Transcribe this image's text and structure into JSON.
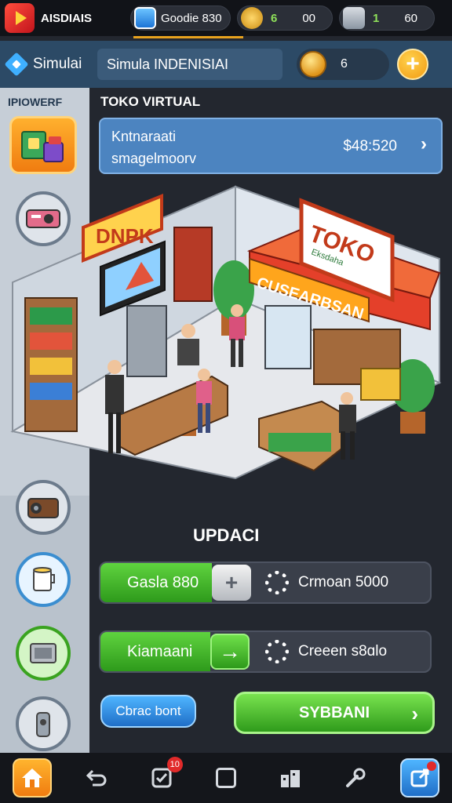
{
  "topbar": {
    "app_name": "AISDIAIS",
    "resource1": "Goodie 830",
    "resource2_green": "6",
    "resource2_value": "00",
    "resource3_green": "1",
    "resource3_value": "60"
  },
  "header": {
    "label": "Simulai",
    "field": "Simula INDENISIAI",
    "coins": "6",
    "plus": "+"
  },
  "sidebar": {
    "title": "IPIOWERF"
  },
  "shop": {
    "title": "TOKO VIRTUAL",
    "info_line1": "Kntnaraati",
    "info_line2": "smagelmoorv",
    "info_price": "$48:520",
    "chevron": "›",
    "scene_sign_left": "DNPK",
    "scene_sign_top": "TOKO",
    "scene_sign_top_sub": "Eksdaha",
    "scene_banner": "CUSEARBSAN"
  },
  "upgrade": {
    "title": "UPDACI",
    "row1_left": "Gasla 880",
    "row1_btn": "+",
    "row1_right": "Crmoan 5000",
    "row2_left": "Kiamaani",
    "row2_btn": "→",
    "row2_right": "Creeen s8ɑlo",
    "pill_button": "Cbrac bont",
    "main_button": "SYBBANI",
    "main_chev": "›"
  },
  "nav": {
    "badge": "10"
  },
  "colors": {
    "accent_orange": "#f29a12",
    "accent_green": "#2e9a1b",
    "accent_blue": "#1f6ec7",
    "header_bg": "#2c4a66"
  }
}
